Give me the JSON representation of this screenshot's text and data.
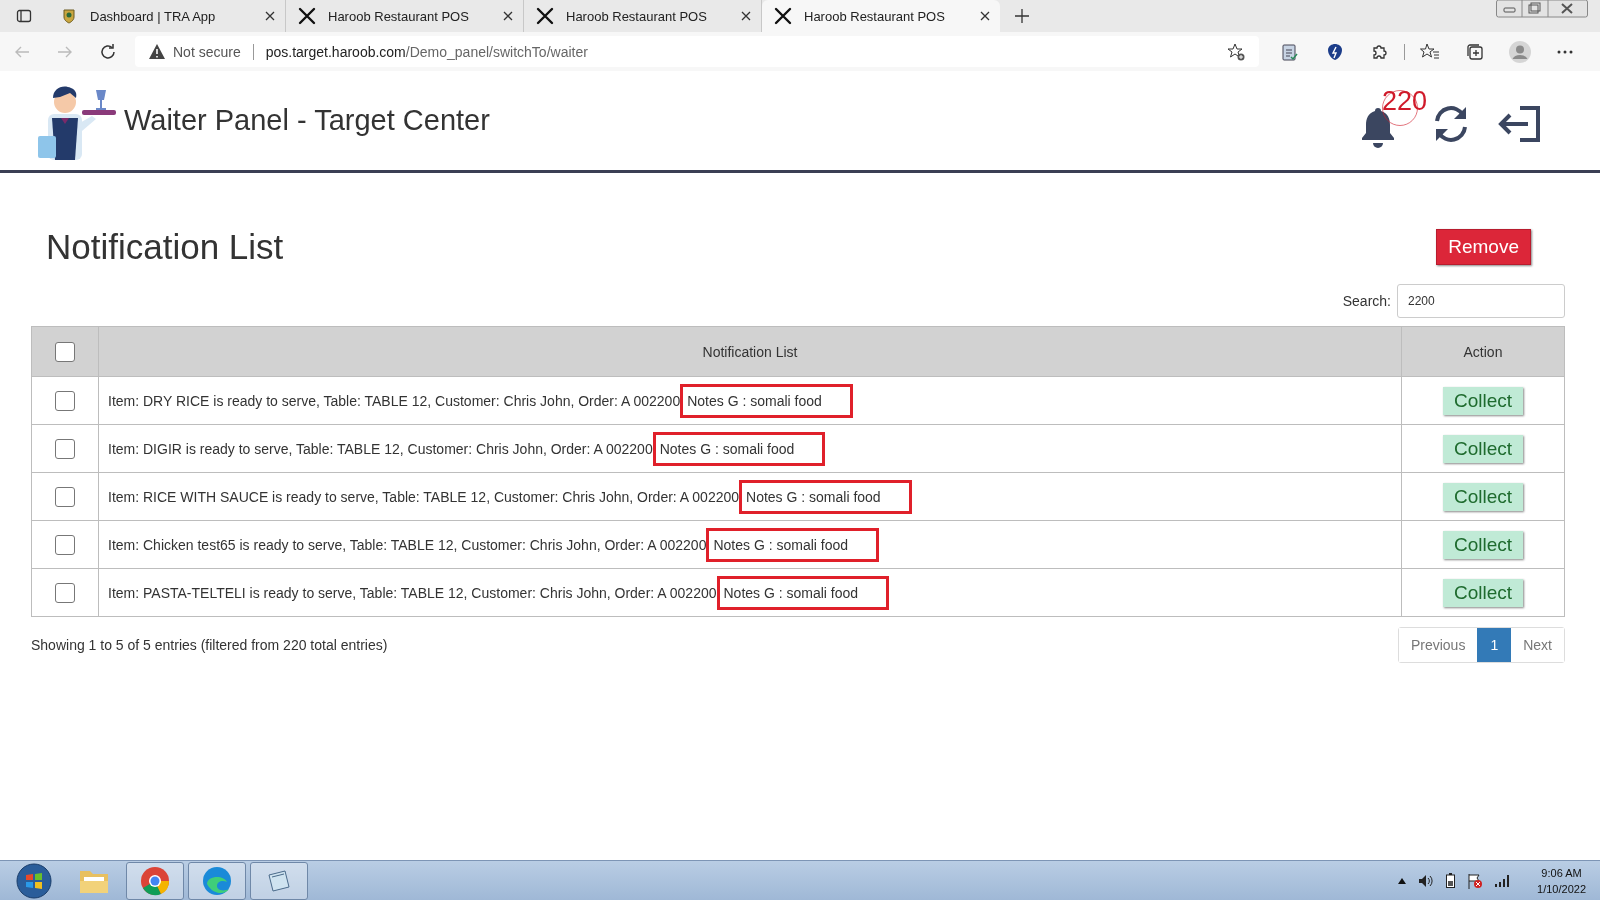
{
  "browser": {
    "tabs": [
      {
        "title": "Dashboard | TRA App",
        "selected": false
      },
      {
        "title": "Haroob Restaurant POS",
        "selected": false
      },
      {
        "title": "Haroob Restaurant POS",
        "selected": false
      },
      {
        "title": "Haroob Restaurant POS",
        "selected": true
      }
    ],
    "security": "Not secure",
    "url_host": "pos.target.haroob.com",
    "url_path": "/Demo_panel/switchTo/waiter"
  },
  "header": {
    "title": "Waiter Panel - Target Center",
    "notification_count": "220"
  },
  "page": {
    "title": "Notification List",
    "remove_button": "Remove",
    "search_label": "Search:",
    "search_value": "2200"
  },
  "table": {
    "select_all_checked": false,
    "columns": [
      "Notification List",
      "Action"
    ],
    "rows": [
      {
        "checked": false,
        "message": "Item: DRY RICE is ready to serve, Table: TABLE 12, Customer: Chris John, Order: A 002200",
        "notes": "Notes G : somali food",
        "highlighted": true,
        "action": "Collect"
      },
      {
        "checked": false,
        "message": "Item: DIGIR is ready to serve, Table: TABLE 12, Customer: Chris John, Order: A 002200",
        "notes": "Notes G : somali food",
        "highlighted": true,
        "action": "Collect"
      },
      {
        "checked": false,
        "message": "Item: RICE WITH SAUCE is ready to serve, Table: TABLE 12, Customer: Chris John, Order: A 002200",
        "notes": "Notes G : somali food",
        "highlighted": true,
        "action": "Collect"
      },
      {
        "checked": false,
        "message": "Item: Chicken test65 is ready to serve, Table: TABLE 12, Customer: Chris John, Order: A 002200",
        "notes": "Notes G : somali food",
        "highlighted": true,
        "action": "Collect"
      },
      {
        "checked": false,
        "message": "Item: PASTA-TELTELI is ready to serve, Table: TABLE 12, Customer: Chris John, Order: A 002200",
        "notes": "Notes G : somali food",
        "highlighted": true,
        "action": "Collect"
      }
    ]
  },
  "footer": {
    "info": "Showing 1 to 5 of 5 entries (filtered from 220 total entries)",
    "pagination": [
      {
        "label": "Previous",
        "selected": false
      },
      {
        "label": "1",
        "selected": true
      },
      {
        "label": "Next",
        "selected": false
      }
    ]
  },
  "taskbar": {
    "time": "9:06 AM",
    "date": "1/10/2022"
  }
}
